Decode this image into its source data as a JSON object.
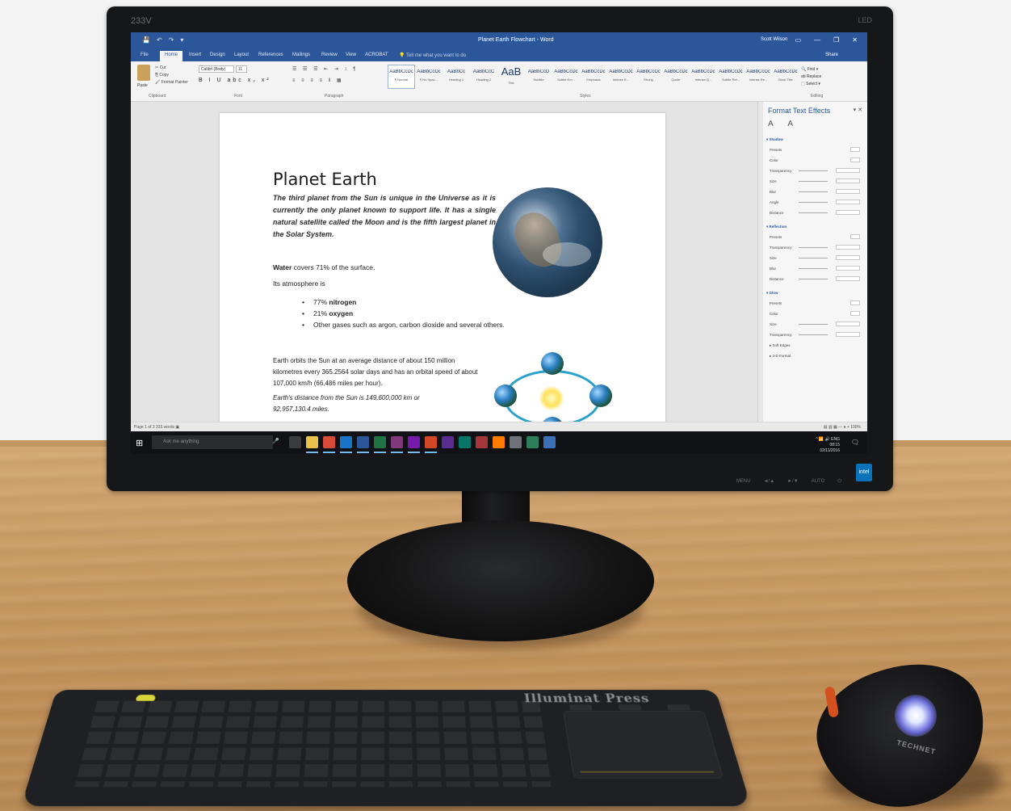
{
  "monitor": {
    "brand": "233V",
    "model_label": "LED",
    "chin_buttons": [
      "MENU",
      "◄/▲",
      "►/▼",
      "AUTO",
      "⏻"
    ],
    "badge": "intel"
  },
  "word": {
    "doc_title": "Planet Earth Flowchart - Word",
    "user_name": "Scott Wilson",
    "quick_access": [
      "💾",
      "↶",
      "↷",
      "▾"
    ],
    "window_controls": [
      "▭",
      "—",
      "❐",
      "✕"
    ],
    "tabs": [
      "File",
      "Home",
      "Insert",
      "Design",
      "Layout",
      "References",
      "Mailings",
      "Review",
      "View",
      "ACROBAT"
    ],
    "active_tab": "Home",
    "tell_me": "💡 Tell me what you want to do",
    "share": "Share",
    "ribbon": {
      "paste": "Paste",
      "clipboard_items": [
        "✂ Cut",
        "⎘ Copy",
        "🖌 Format Painter"
      ],
      "font_name": "Calibri (Body)",
      "font_size": "11",
      "format_buttons": "B I U abc x₂ x²",
      "para_row1": "☰ ☰ ☰ ⇤ ⇥ ↕ ¶",
      "para_row2": "≡ ≡ ≡ ≡ ‖ ▦",
      "group_labels": [
        "Clipboard",
        "Font",
        "Paragraph",
        "Styles",
        "Editing"
      ],
      "editing": [
        "🔍 Find ▾",
        "ab Replace",
        "⬚ Select ▾"
      ],
      "styles": [
        {
          "sample": "AaBbCcDc",
          "name": "¶ Normal",
          "selected": true,
          "big": false
        },
        {
          "sample": "AaBbCcDc",
          "name": "¶ No Spac...",
          "selected": false,
          "big": false
        },
        {
          "sample": "AaBbCc",
          "name": "Heading 1",
          "selected": false,
          "big": false
        },
        {
          "sample": "AaBbCcC",
          "name": "Heading 2",
          "selected": false,
          "big": false
        },
        {
          "sample": "AaB",
          "name": "Title",
          "selected": false,
          "big": true
        },
        {
          "sample": "AaBbCcD",
          "name": "Subtitle",
          "selected": false,
          "big": false
        },
        {
          "sample": "AaBbCcDc",
          "name": "Subtle Em...",
          "selected": false,
          "big": false
        },
        {
          "sample": "AaBbCcDc",
          "name": "Emphasis",
          "selected": false,
          "big": false
        },
        {
          "sample": "AaBbCcDc",
          "name": "Intense E...",
          "selected": false,
          "big": false
        },
        {
          "sample": "AaBbCcDc",
          "name": "Strong",
          "selected": false,
          "big": false
        },
        {
          "sample": "AaBbCcDc",
          "name": "Quote",
          "selected": false,
          "big": false
        },
        {
          "sample": "AaBbCcDc",
          "name": "Intense Q...",
          "selected": false,
          "big": false
        },
        {
          "sample": "AaBbCcDc",
          "name": "Subtle Ref...",
          "selected": false,
          "big": false
        },
        {
          "sample": "AaBbCcDc",
          "name": "Intense Re...",
          "selected": false,
          "big": false
        },
        {
          "sample": "AaBbCcDc",
          "name": "Book Title",
          "selected": false,
          "big": false
        }
      ]
    },
    "document": {
      "title": "Planet Earth",
      "intro": "The third planet from the Sun is unique in the Universe as it is currently the only planet known to support life. It has a single natural satellite called the Moon and is the fifth largest planet in the Solar System.",
      "water_bold": "Water",
      "water_rest": " covers 71% of the surface.",
      "atmosphere": "Its atmosphere is",
      "list": [
        {
          "pre": "77% ",
          "bold": "nitrogen",
          "post": ""
        },
        {
          "pre": "21% ",
          "bold": "oxygen",
          "post": ""
        },
        {
          "pre": "Other gases such as argon, carbon dioxide and several others.",
          "bold": "",
          "post": ""
        }
      ],
      "orbit": "Earth orbits the Sun at an average distance of about 150 million kilometres every 365.2564 solar days and has an orbital speed of about 107,000 km/h (66,486 miles per hour).",
      "distance": "Earth's distance from the Sun is 149,600,000 km or 92,957,130.4 miles."
    },
    "pane": {
      "title": "Format Text Effects",
      "close": "▾ ✕",
      "icons": "A A",
      "rows": [
        {
          "label": "▾ Shadow",
          "header": true,
          "ctl": ""
        },
        {
          "label": "Presets",
          "header": false,
          "ctl": "sm"
        },
        {
          "label": "Color",
          "header": false,
          "ctl": "sm"
        },
        {
          "label": "Transparency",
          "header": false,
          "ctl": "slider"
        },
        {
          "label": "Size",
          "header": false,
          "ctl": "slider"
        },
        {
          "label": "Blur",
          "header": false,
          "ctl": "slider"
        },
        {
          "label": "Angle",
          "header": false,
          "ctl": "slider"
        },
        {
          "label": "Distance",
          "header": false,
          "ctl": "slider"
        },
        {
          "label": "▾ Reflection",
          "header": true,
          "ctl": ""
        },
        {
          "label": "Presets",
          "header": false,
          "ctl": "sm"
        },
        {
          "label": "Transparency",
          "header": false,
          "ctl": "slider"
        },
        {
          "label": "Size",
          "header": false,
          "ctl": "slider"
        },
        {
          "label": "Blur",
          "header": false,
          "ctl": "slider"
        },
        {
          "label": "Distance",
          "header": false,
          "ctl": "slider"
        },
        {
          "label": "▾ Glow",
          "header": true,
          "ctl": ""
        },
        {
          "label": "Presets",
          "header": false,
          "ctl": "sm"
        },
        {
          "label": "Color",
          "header": false,
          "ctl": "sm"
        },
        {
          "label": "Size",
          "header": false,
          "ctl": "slider"
        },
        {
          "label": "Transparency",
          "header": false,
          "ctl": "slider"
        },
        {
          "label": "▸ Soft Edges",
          "header": false,
          "ctl": ""
        },
        {
          "label": "▸ 3-D Format",
          "header": false,
          "ctl": ""
        }
      ]
    },
    "status": {
      "left": "Page 1 of 3    333 words    ▣",
      "right": "▤  ▥  ▦   —  ●  +  100%"
    }
  },
  "taskbar": {
    "start": "⊞",
    "search_placeholder": "Ask me anything",
    "mic": "🎤",
    "tray": "^ 📶 🔊 ENG",
    "clock": "08:15\n02/11/2016",
    "notification": "🗨",
    "apps": [
      {
        "name": "task-view",
        "color": "#3a3c40"
      },
      {
        "name": "file-explorer",
        "color": "#e8c24a"
      },
      {
        "name": "chrome",
        "color": "#d94a38"
      },
      {
        "name": "outlook",
        "color": "#1a74c8"
      },
      {
        "name": "word",
        "color": "#2b579a"
      },
      {
        "name": "excel",
        "color": "#217346"
      },
      {
        "name": "onenote",
        "color": "#80397b"
      },
      {
        "name": "onenote-2",
        "color": "#7719aa"
      },
      {
        "name": "powerpoint",
        "color": "#d24726"
      },
      {
        "name": "visual-studio",
        "color": "#5c2d91"
      },
      {
        "name": "publisher",
        "color": "#077568"
      },
      {
        "name": "access",
        "color": "#a4373a"
      },
      {
        "name": "illustrator",
        "color": "#ff7c00"
      },
      {
        "name": "app-grey",
        "color": "#6f7378"
      },
      {
        "name": "app-green",
        "color": "#2e7d5b"
      },
      {
        "name": "app-blue",
        "color": "#3b6fb6"
      }
    ]
  },
  "keyboard": {
    "brand": "Illuminat Press"
  },
  "mouse": {
    "brand": "TECHNET"
  }
}
